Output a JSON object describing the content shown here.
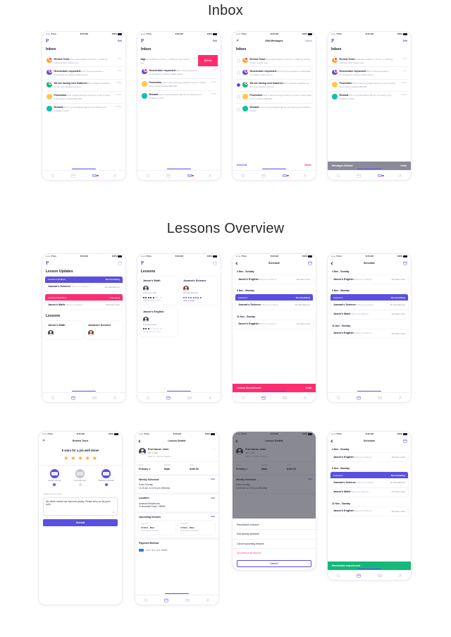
{
  "sections": {
    "inbox_title": "Inbox",
    "lessons_title": "Lessons Overview"
  },
  "status_bar": {
    "carrier": "••••• Plan",
    "time": "8:30 AM",
    "battery": "100%"
  },
  "tabbar": {
    "search": "search-icon",
    "lessons": "calendar-icon",
    "inbox": "mail-icon",
    "profile": "person-icon"
  },
  "inbox": {
    "page_title": "Inbox",
    "edit_label": "Edit",
    "cancel_label": "Cancel",
    "edit_title": "Edit Messages",
    "select_all": "Select all",
    "delete": "Delete",
    "swipe_delete": "Delete",
    "toast_deleted": "Messages Deleted",
    "toast_undo": "Undo",
    "messages": [
      {
        "title": "Review Tutor",
        "preview": "Show appreciation to Prof A. J. Halls by writing a tutor review now",
        "time": "1 hr",
        "color": "#ffa726",
        "read": false
      },
      {
        "title": "Reschedule requested",
        "preview": "Jason Teng requested a reschedule for Glady's Math lesson",
        "time": "1 hr",
        "color": "#5a4fe0",
        "read": false
      },
      {
        "title": "We are having new features!",
        "preview": "More subjects available on the new updated version.",
        "time": "1 day",
        "color": "#15b87a",
        "read": false
      },
      {
        "title": "Promotion",
        "preview": "Invite a friend and get chances to win in lucky draw prizes totalling $50,000",
        "time": "5 Nov",
        "color": "#ffc94d",
        "read": true
      },
      {
        "title": "Reward",
        "preview": "Here's a personalised gift for you during your birthday month!",
        "time": "5 Nov",
        "color": "#0fbfb0",
        "read": true
      }
    ],
    "swiped": {
      "title": "Jdgr",
      "preview": "appreciation to Prof A. J. Halls by tutor review now"
    }
  },
  "lesson_updates": {
    "page_title": "Lesson Updates",
    "section_lessons": "Lessons",
    "items": [
      {
        "bar_left": "Lesson 1 (5 Nov)",
        "bar_right": "Rescheduling",
        "bar_color": "purple",
        "title": "Joanna's Science",
        "time": "1:00 pm to 2:30 pm",
        "tutor": "Ms Clara Belmont"
      },
      {
        "bar_left": "Lesson 4 (13 Nov)",
        "bar_right": "Cancelled",
        "bar_color": "pink",
        "title": "Jason's Math",
        "time": "1:00 pm to 2:30 pm",
        "tutor": "Prof Aaron John"
      }
    ],
    "cards": [
      {
        "title": "Jason's Math",
        "tutor": "Prof Aaron John"
      },
      {
        "title": "Joanna's Science",
        "tutor": "Ms Clara Belmont"
      }
    ]
  },
  "lessons_grid": {
    "page_title": "Lessons",
    "cards": [
      {
        "title": "Jason's Math",
        "tutor": "Prof Aaron John",
        "filled": 5,
        "total": 8,
        "footer": "Next lesson in 3 hours"
      },
      {
        "title": "Joanna's Science",
        "tutor": "Ms Clara Belmont",
        "filled": 8,
        "total": 8,
        "footer": "Click to review"
      },
      {
        "title": "Jason's English",
        "tutor": "Prof Aaron John",
        "filled": 3,
        "total": 8,
        "footer": "Next lesson in 2 hours"
      }
    ]
  },
  "schedule": {
    "page_title": "Schedule",
    "toast_discontinued": "Lesson Discontinued",
    "toast_undo": "Undo",
    "toast_sent": "Reschedule request sent",
    "days": [
      {
        "label": "4 Nov - Sunday",
        "entries": [
          {
            "title": "Jason's English",
            "time": "3:00 pm to 4:00 pm",
            "tutor": "Prof Aaron John",
            "bar_left": "",
            "bar_right": ""
          }
        ]
      },
      {
        "label": "5 Nov - Monday",
        "entries": [
          {
            "title": "Joanna's Science",
            "time": "1:00 pm to 2:30 pm",
            "tutor": "Ms Clara Belmont",
            "bar_left": "Lesson 1",
            "bar_right": "Rescheduling"
          },
          {
            "title": "Jason's Math",
            "time": "2:00 pm to 3:00 pm",
            "tutor": "Prof Aaron John",
            "bar_left": "",
            "bar_right": ""
          }
        ]
      },
      {
        "label": "11 Nov - Sunday",
        "entries": [
          {
            "title": "Jason's English",
            "time": "3:00 pm to 4:00 pm",
            "tutor": "Prof Aaron John",
            "bar_left": "",
            "bar_right": ""
          }
        ]
      }
    ]
  },
  "review": {
    "page_title": "Review Tutor",
    "headline": "5 stars for a job well done!",
    "stars": 5,
    "badges": [
      {
        "label": "Grades Climber",
        "selected": true
      },
      {
        "label": "Punctual Tutor",
        "selected": false
      },
      {
        "label": "Reliable Schedule",
        "selected": true
      }
    ],
    "comments_label": "Additional Comments",
    "comments_value": "My child's results has improved greatly. Please keep up the good work.",
    "char_count": "146",
    "submit_label": "Submit"
  },
  "lesson_details": {
    "page_title": "Lesson Details",
    "tutor_name": "Prof Aaron John",
    "rating": "4/5",
    "reviews": "(20)",
    "price_line": "$180 /hr  •  Partner Teacher",
    "specs": [
      {
        "key": "Level",
        "value": "Primary 1"
      },
      {
        "key": "Subject",
        "value": "Math"
      },
      {
        "key": "Cost",
        "value": "$150.00"
      }
    ],
    "weekly": {
      "heading": "Weekly Schedule",
      "edit": "Edit",
      "line1": "Every Sunday",
      "line2": "11:30 am to 12:30 pm (90mins)"
    },
    "location": {
      "heading": "Location",
      "edit": "Edit",
      "line1": "Anamaki Residences",
      "line2": "10 Anamaki Road, 138960"
    },
    "upcoming": {
      "heading": "Upcoming lessons",
      "edit": "Edit",
      "items": [
        {
          "key": "Lesson 7",
          "date": "12 Nov - Mon",
          "time": "11:30 am to 12:30 pm"
        },
        {
          "key": "Lesson 8",
          "date": "14 Nov - Wed",
          "time": "11:30 am to 12:30 pm"
        }
      ]
    },
    "payment": {
      "heading": "Payment Method",
      "masked": "•••• •••• ••••  6182"
    },
    "action_sheet": {
      "items": [
        "Reschedule a lesson",
        "Edit weekly schedule",
        "Cancel upcoming lessons"
      ],
      "danger": "Discontinue all lessons",
      "cancel": "Cancel"
    }
  }
}
